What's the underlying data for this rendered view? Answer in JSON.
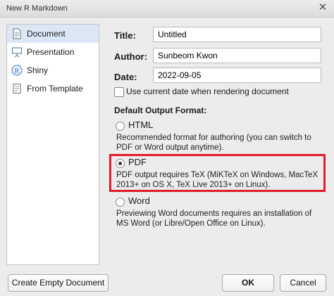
{
  "window": {
    "title": "New R Markdown"
  },
  "sidebar": {
    "items": [
      {
        "label": "Document",
        "icon": "document-icon",
        "selected": true
      },
      {
        "label": "Presentation",
        "icon": "presentation-icon",
        "selected": false
      },
      {
        "label": "Shiny",
        "icon": "shiny-icon",
        "selected": false
      },
      {
        "label": "From Template",
        "icon": "template-icon",
        "selected": false
      }
    ]
  },
  "form": {
    "title_label": "Title:",
    "title_value": "Untitled",
    "author_label": "Author:",
    "author_value": "Sunbeom Kwon",
    "date_label": "Date:",
    "date_value": "2022-09-05",
    "use_current_date_label": "Use current date when rendering document",
    "use_current_date_checked": false
  },
  "output": {
    "section_label": "Default Output Format:",
    "selected": "PDF",
    "options": [
      {
        "label": "HTML",
        "desc1": "Recommended format for authoring (you can switch to",
        "desc2": "PDF or Word output anytime)."
      },
      {
        "label": "PDF",
        "desc1": "PDF output requires TeX (MiKTeX on Windows, MacTeX",
        "desc2": "2013+ on OS X, TeX Live 2013+ on Linux)."
      },
      {
        "label": "Word",
        "desc1": "Previewing Word documents requires an installation of",
        "desc2": "MS Word (or Libre/Open Office on Linux)."
      }
    ]
  },
  "buttons": {
    "create_empty": "Create Empty Document",
    "ok": "OK",
    "cancel": "Cancel"
  },
  "colors": {
    "highlight": "#e4192a",
    "selected_bg": "#dce7f6"
  }
}
